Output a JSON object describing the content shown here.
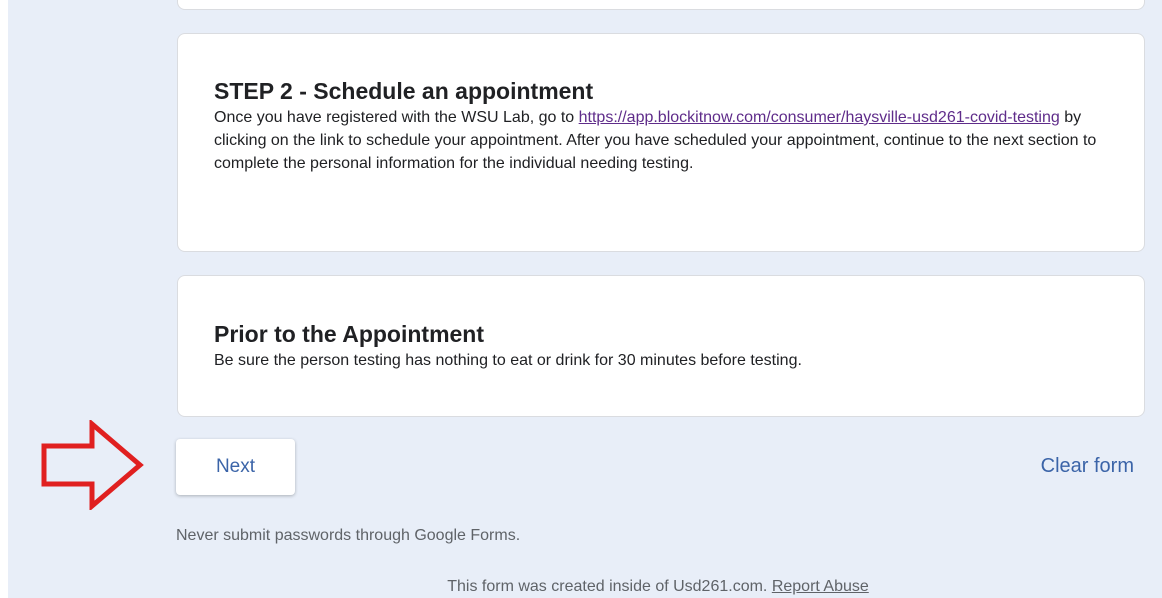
{
  "cards": {
    "step2": {
      "title": "STEP 2 - Schedule an appointment",
      "body_before_link": "Once you have registered with the WSU Lab, go to ",
      "link_text": "https://app.blockitnow.com/consumer/haysville-usd261-covid-testing",
      "body_after_link": " by clicking on the link to schedule your appointment.  After you have scheduled your appointment, continue to the next section to complete the personal information for the individual needing testing."
    },
    "prior": {
      "title": "Prior to the Appointment",
      "body": "Be sure the person testing has nothing to eat or drink for 30 minutes before testing."
    }
  },
  "nav": {
    "next_label": "Next",
    "clear_label": "Clear form"
  },
  "warning": "Never submit passwords through Google Forms.",
  "footer": {
    "created_text": "This form was created inside of Usd261.com. ",
    "report_label": "Report Abuse"
  },
  "colors": {
    "background": "#e8eef8",
    "accent": "#3b64a8",
    "link": "#5f2c8a",
    "annotation_arrow": "#e02020"
  },
  "annotation": {
    "icon": "red-outline-arrow-right-icon"
  }
}
